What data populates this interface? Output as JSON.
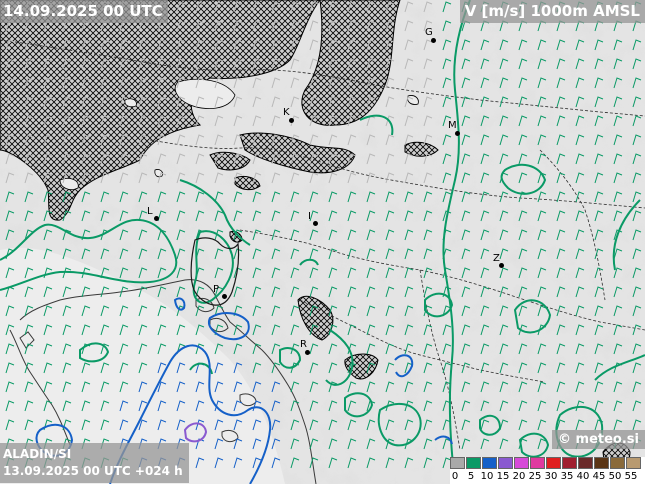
{
  "header": {
    "valid_time": "14.09.2025 00 UTC",
    "field": "V [m/s] 1000m AMSL"
  },
  "footer": {
    "model": "ALADIN/SI",
    "run_info": "13.09.2025 00 UTC +024 h",
    "copyright": "© meteo.si"
  },
  "cities": [
    {
      "name": "G"
    },
    {
      "name": "K"
    },
    {
      "name": "M"
    },
    {
      "name": "L"
    },
    {
      "name": "I"
    },
    {
      "name": "Z"
    },
    {
      "name": "P"
    },
    {
      "name": "R"
    }
  ],
  "legend": {
    "ticks": [
      "0",
      "5",
      "10",
      "15",
      "20",
      "25",
      "30",
      "35",
      "40",
      "45",
      "50",
      "55"
    ],
    "colors": [
      "#a9a9a9",
      "#0a9a66",
      "#1560c8",
      "#8a5ad0",
      "#d64ad8",
      "#e03aa0",
      "#e02020",
      "#a02030",
      "#6a2a2a",
      "#5a3515",
      "#8a6a3a",
      "#b89a70"
    ]
  },
  "colors": {
    "terrain": "#e4e4e4",
    "cloud": "#8c8c8c",
    "contour_5": "#0a9a66",
    "contour_10": "#1560c8",
    "contour_15": "#8a5ad0"
  }
}
